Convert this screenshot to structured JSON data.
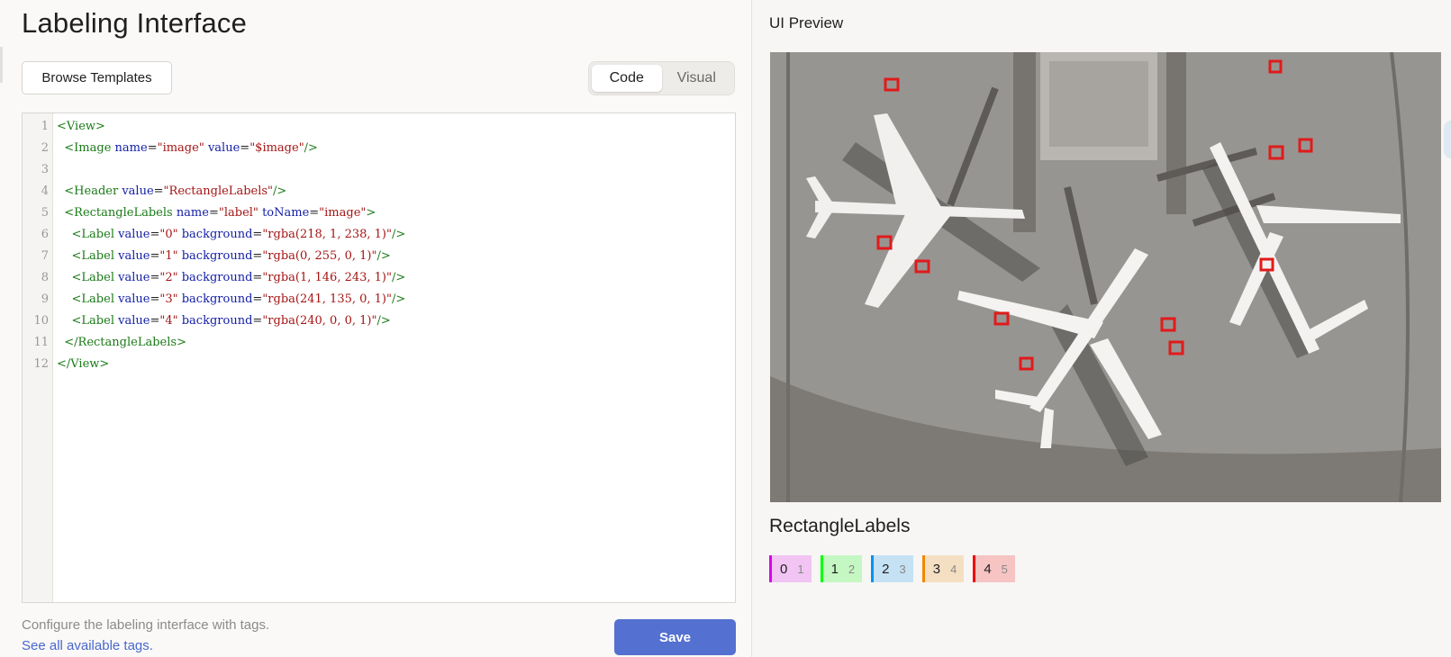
{
  "page_title": "Labeling Interface",
  "browse_button": "Browse Templates",
  "mode_toggle": {
    "options": [
      "Code",
      "Visual"
    ],
    "selected": "Code"
  },
  "editor": {
    "line_numbers": [
      "1",
      "2",
      "3",
      "4",
      "5",
      "6",
      "7",
      "8",
      "9",
      "10",
      "11",
      "12"
    ],
    "lines": [
      "<View>",
      "  <Image name=\"image\" value=\"$image\"/>",
      "",
      "  <Header value=\"RectangleLabels\"/>",
      "  <RectangleLabels name=\"label\" toName=\"image\">",
      "    <Label value=\"0\" background=\"rgba(218, 1, 238, 1)\"/>",
      "    <Label value=\"1\" background=\"rgba(0, 255, 0, 1)\"/>",
      "    <Label value=\"2\" background=\"rgba(1, 146, 243, 1)\"/>",
      "    <Label value=\"3\" background=\"rgba(241, 135, 0, 1)\"/>",
      "    <Label value=\"4\" background=\"rgba(240, 0, 0, 1)\"/>",
      "  </RectangleLabels>",
      "</View>"
    ]
  },
  "hint_text": "Configure the labeling interface with tags.",
  "hint_link": "See all available tags.",
  "save_button": "Save",
  "preview": {
    "title": "UI Preview",
    "header": "RectangleLabels",
    "labels": [
      {
        "value": "0",
        "hotkey": "1",
        "color": "#da01ee"
      },
      {
        "value": "1",
        "hotkey": "2",
        "color": "#00ff00"
      },
      {
        "value": "2",
        "hotkey": "3",
        "color": "#0192f3"
      },
      {
        "value": "3",
        "hotkey": "4",
        "color": "#f18700"
      },
      {
        "value": "4",
        "hotkey": "5",
        "color": "#f00000"
      }
    ]
  }
}
